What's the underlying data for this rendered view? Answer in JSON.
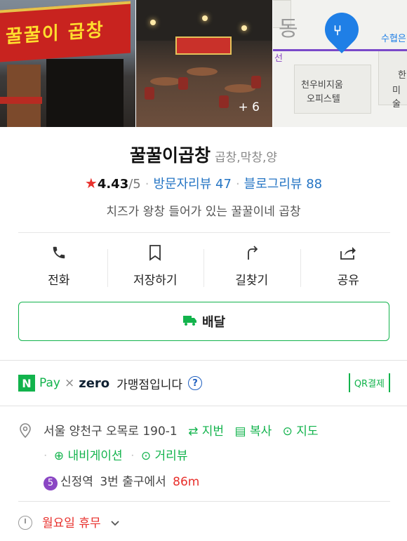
{
  "photos": {
    "more_count": "+ 6",
    "sign_text": "꿀꿀이 곱창"
  },
  "map": {
    "label_station": "수협은",
    "label_dong": "동",
    "label_building_1": "천우비지움",
    "label_building_2": "오피스텔",
    "label_side": "한",
    "label_side2": "미술",
    "label_sun": "선"
  },
  "place": {
    "name": "꿀꿀이곱창",
    "category": "곱창,막창,양",
    "rating": "4.43",
    "rating_outof": "/5",
    "visitor_reviews": "방문자리뷰 47",
    "blog_reviews": "블로그리뷰 88",
    "description": "치즈가 왕창 들어가 있는 꿀꿀이네 곱창"
  },
  "actions": {
    "call": "전화",
    "save": "저장하기",
    "directions": "길찾기",
    "share": "공유"
  },
  "delivery": {
    "label": "배달"
  },
  "pay": {
    "n": "N",
    "pay": "Pay",
    "times": "×",
    "zero": "zero",
    "merchant_text": "가맹점입니다",
    "help": "?",
    "qr": "QR결제"
  },
  "address": {
    "road": "서울 양천구 오목로 190-1",
    "lot_number": "지번",
    "copy": "복사",
    "map": "지도",
    "navigation": "내비게이션",
    "street_view": "거리뷰",
    "subway_line": "5",
    "station": "신정역",
    "exit": "3번 출구에서",
    "distance": "86m"
  },
  "hours": {
    "status": "월요일 휴무"
  },
  "colors": {
    "naver_green": "#12b34c",
    "link_blue": "#2575c4",
    "star_red": "#e8302c",
    "line5_purple": "#8a46c4"
  }
}
